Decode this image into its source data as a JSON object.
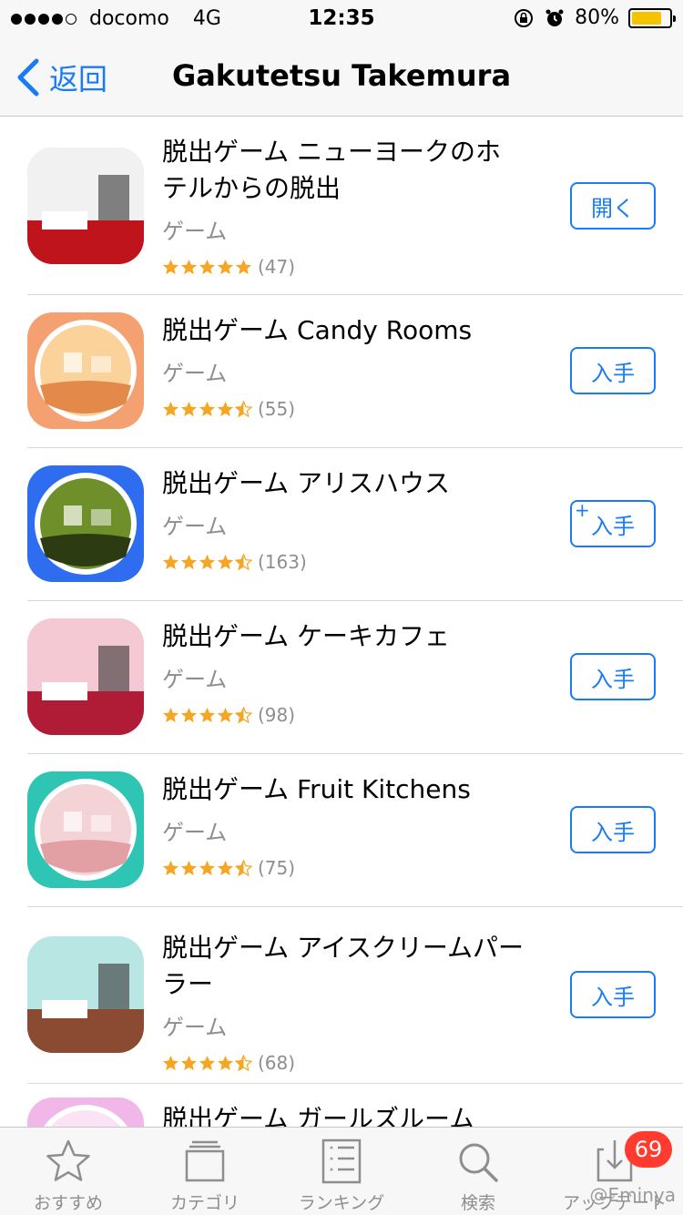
{
  "status": {
    "carrier": "docomo",
    "network": "4G",
    "time": "12:35",
    "battery": "80%",
    "battery_level": 0.8
  },
  "nav": {
    "back_label": "返回",
    "title": "Gakutetsu Takemura"
  },
  "apps": [
    {
      "name": "脱出ゲーム ニューヨークのホテルからの脱出",
      "category": "ゲーム",
      "rating": 5.0,
      "count": "(47)",
      "action": "開く",
      "has_plus": false
    },
    {
      "name": "脱出ゲーム Candy Rooms",
      "category": "ゲーム",
      "rating": 4.5,
      "count": "(55)",
      "action": "入手",
      "has_plus": false
    },
    {
      "name": "脱出ゲーム アリスハウス",
      "category": "ゲーム",
      "rating": 4.5,
      "count": "(163)",
      "action": "入手",
      "has_plus": true
    },
    {
      "name": "脱出ゲーム ケーキカフェ",
      "category": "ゲーム",
      "rating": 4.5,
      "count": "(98)",
      "action": "入手",
      "has_plus": false
    },
    {
      "name": "脱出ゲーム Fruit Kitchens",
      "category": "ゲーム",
      "rating": 4.5,
      "count": "(75)",
      "action": "入手",
      "has_plus": false
    },
    {
      "name": "脱出ゲーム アイスクリームパーラー",
      "category": "ゲーム",
      "rating": 4.5,
      "count": "(68)",
      "action": "入手",
      "has_plus": false
    },
    {
      "name": "脱出ゲーム ガールズルーム",
      "category": "",
      "rating": null,
      "count": "",
      "action": "",
      "has_plus": false
    }
  ],
  "tabs": [
    {
      "label": "おすすめ",
      "icon": "star-icon"
    },
    {
      "label": "カテゴリ",
      "icon": "categories-icon"
    },
    {
      "label": "ランキング",
      "icon": "ranking-icon"
    },
    {
      "label": "検索",
      "icon": "search-icon"
    },
    {
      "label": "アップデート",
      "icon": "updates-icon",
      "badge": "69"
    }
  ],
  "watermark": "@Eminya",
  "colors": {
    "accent": "#1a7cf5",
    "star": "#f5a623",
    "badge": "#ff3b30",
    "battery": "#f5c400"
  }
}
